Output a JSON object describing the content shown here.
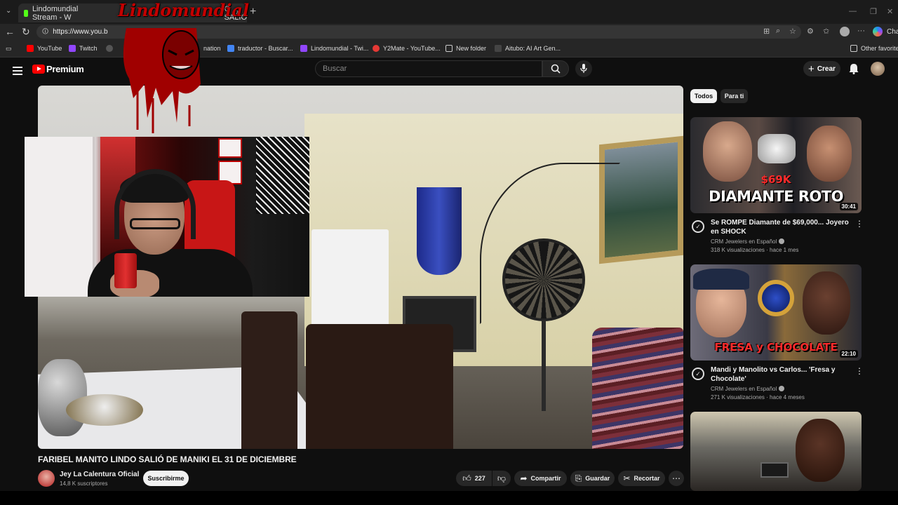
{
  "browser": {
    "tab_title": "Lindomundial Stream - W",
    "tab_title_tail": "O SALIÓ",
    "url": "https://www.you.b",
    "bookmarks": [
      "YouTube",
      "Twitch",
      "nation",
      "traductor - Buscar...",
      "Lindomundial - Twi...",
      "Y2Mate - YouTube...",
      "New folder",
      "Aitubo: AI Art Gen..."
    ],
    "other_favorites": "Other favorites",
    "copilot_label": "Cha"
  },
  "youtube": {
    "logo_text": "Premium",
    "search_placeholder": "Buscar",
    "create_label": "Crear"
  },
  "overlay": {
    "brand": "Lindomundial"
  },
  "video": {
    "title": "FARIBEL MANITO LINDO SALIÓ DE MANIKI EL 31 DE DICIEMBRE",
    "channel": "Jey La Calentura Oficial",
    "subscribers": "14,8 K suscriptores",
    "subscribe_label": "Suscribirme",
    "likes": "227",
    "share_label": "Compartir",
    "save_label": "Guardar",
    "clip_label": "Recortar"
  },
  "sidebar": {
    "chips": [
      "Todos",
      "Para ti"
    ],
    "videos": [
      {
        "thumb_text": "DIAMANTE ROTO",
        "thumb_price": "$69K",
        "duration": "30:41",
        "title": "Se ROMPE Diamante de $69,000... Joyero en SHOCK",
        "channel": "CRM Jewelers en Español",
        "meta": "318 K visualizaciones · hace 1 mes"
      },
      {
        "thumb_text": "FRESA y CHOCOLATE",
        "duration": "22:10",
        "title": "Mandi y Manolito vs Carlos... 'Fresa y Chocolate'",
        "channel": "CRM Jewelers en Español",
        "meta": "271 K visualizaciones · hace 4 meses"
      }
    ]
  },
  "colors": {
    "youtube_red": "#ff0000",
    "background": "#0f0f0f",
    "chip_active": "#f1f1f1"
  }
}
